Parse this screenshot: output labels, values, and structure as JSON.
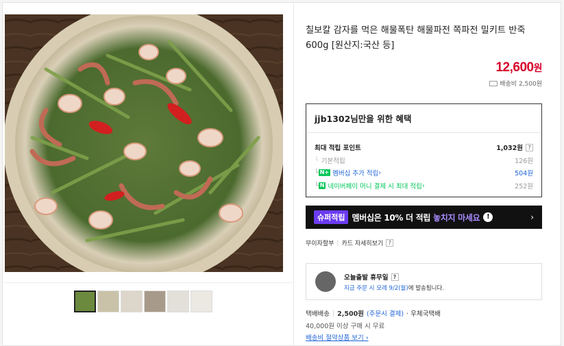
{
  "product": {
    "title": "칠보칼 감자를 먹은 해물폭탄 해물파전 쪽파전 밀키트 반죽 600g [원산지:국산 등]",
    "price_number": "12,600",
    "price_unit": "원",
    "shipping_label": "배송비 2,500원"
  },
  "benefit": {
    "heading": "jjb1302님만을 위한 혜택",
    "max_label": "최대 적립 포인트",
    "max_value": "1,032원",
    "help": "?",
    "rows": [
      {
        "label": "기본적립",
        "value": "126원"
      },
      {
        "badge": "N+",
        "label": "멤버십 추가 적립",
        "value": "504원"
      },
      {
        "badge": "N",
        "label": "네이버페이 머니 결제 시 최대 적립",
        "value": "252원"
      }
    ]
  },
  "banner": {
    "tag": "슈퍼적립",
    "msg_a": "멤버십은 ",
    "msg_b": "10% 더 적립",
    "msg_c": " 놓치지 마세요",
    "excl": "!",
    "arrow": "›"
  },
  "links": {
    "installment": "무이자할부",
    "card": "카드 자세히보기",
    "help": "?"
  },
  "today": {
    "title": "오늘출발 휴무일",
    "help": "?",
    "desc_blue": "지금 주문 시 모레 9/2(월)",
    "desc_rest": "에 발송됩니다."
  },
  "delivery": {
    "type": "택배배송",
    "fee": "2,500원",
    "fee_note": "(주문시 결제)",
    "carrier": "· 우체국택배",
    "free": "40,000원 이상 구매 시 무료",
    "save_link": "배송비 절약상품 보기 ›"
  },
  "colors": {
    "price": "#d6002b",
    "naver_green": "#03c75a",
    "link_blue": "#1e64d7",
    "super_purple": "#6b3cf0"
  }
}
